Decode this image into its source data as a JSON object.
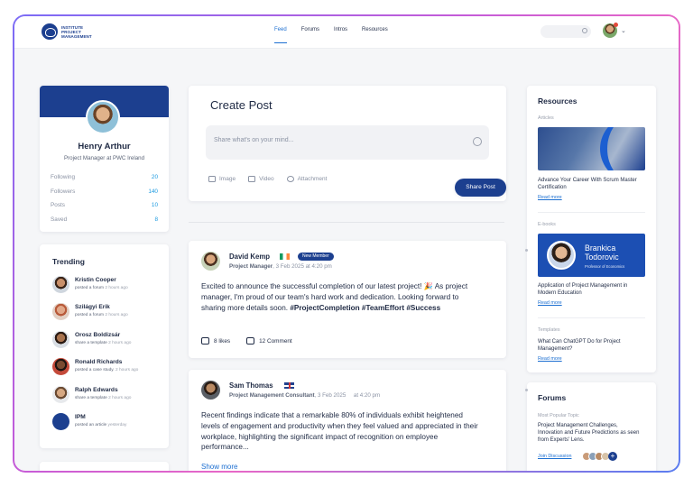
{
  "logo": {
    "text": "INSTITUTE PROJECT MANAGEMENT"
  },
  "nav": {
    "links": [
      "Feed",
      "Forums",
      "Intros",
      "Resources"
    ],
    "active": "Feed"
  },
  "profile": {
    "name": "Henry Arthur",
    "role": "Project Manager at PWC Ireland",
    "stats": [
      {
        "label": "Following",
        "value": "20"
      },
      {
        "label": "Followers",
        "value": "140"
      },
      {
        "label": "Posts",
        "value": "10"
      },
      {
        "label": "Saved",
        "value": "8"
      }
    ]
  },
  "trending": {
    "title": "Trending",
    "items": [
      {
        "name": "Kristin Cooper",
        "action": "posted a forum",
        "time": "2 hours ago"
      },
      {
        "name": "Szilágyi Erik",
        "action": "posted a forum",
        "time": "2 hours ago"
      },
      {
        "name": "Orosz Boldizsár",
        "action": "share a template",
        "time": "2 hours ago"
      },
      {
        "name": "Ronald Richards",
        "action": "posted a case study.",
        "time": "2 hours ago"
      },
      {
        "name": "Ralph Edwards",
        "action": "share a template",
        "time": "2 hours ago"
      },
      {
        "name": "IPM",
        "action": "posted an article",
        "time": "yesterday"
      }
    ]
  },
  "create_post": {
    "title": "Create Post",
    "placeholder": "Share what's on your mind...",
    "image_label": "Image",
    "video_label": "Video",
    "attachment_label": "Attachment",
    "share_label": "Share Post"
  },
  "posts": [
    {
      "author": "David Kemp",
      "badge": "New Member",
      "role": "Project Manager",
      "date": ", 3 Feb 2025 at 4:20 pm",
      "body": "Excited to announce the successful completion of our latest project! 🎉 As project manager, I'm proud of our team's hard work and dedication. Looking forward to sharing more details soon. ",
      "tags": "#ProjectCompletion #TeamEffort #Success",
      "likes": "8 likes",
      "comments": "12 Comment"
    },
    {
      "author": "Sam Thomas",
      "role": "Project Management Consultant",
      "date": ", 3 Feb 2025",
      "time": "at 4:20 pm",
      "body": "Recent findings indicate that a remarkable 80% of individuals exhibit heightened levels of engagement and productivity when they feel valued and appreciated in their workplace, highlighting the significant impact  of recognition on employee performance...",
      "show_more": "Show more"
    }
  ],
  "resources": {
    "title": "Resources",
    "articles_label": "Articles",
    "article_title": "Advance Your Career With Scrum Master Certification",
    "read_more": "Read more",
    "ebooks_label": "E-books",
    "ebook_author": "Brankica Todorovic",
    "ebook_author_sub": "Professor of Economics",
    "ebook_title": "Application of Project Management in Modern Education",
    "templates_label": "Templates",
    "template_title": "What Can ChatGPT Do for Project Management?"
  },
  "forums": {
    "title": "Forums",
    "popular_label": "Most Popular Topic",
    "topic": "Project Management Challenges, Innovation and Future Predictions as seen from Experts' Lens.",
    "join_label": "Join Discussion"
  },
  "colors": {
    "brand": "#1c3f8f",
    "link": "#1c6fd1",
    "stat_value": "#1c9ae0"
  }
}
